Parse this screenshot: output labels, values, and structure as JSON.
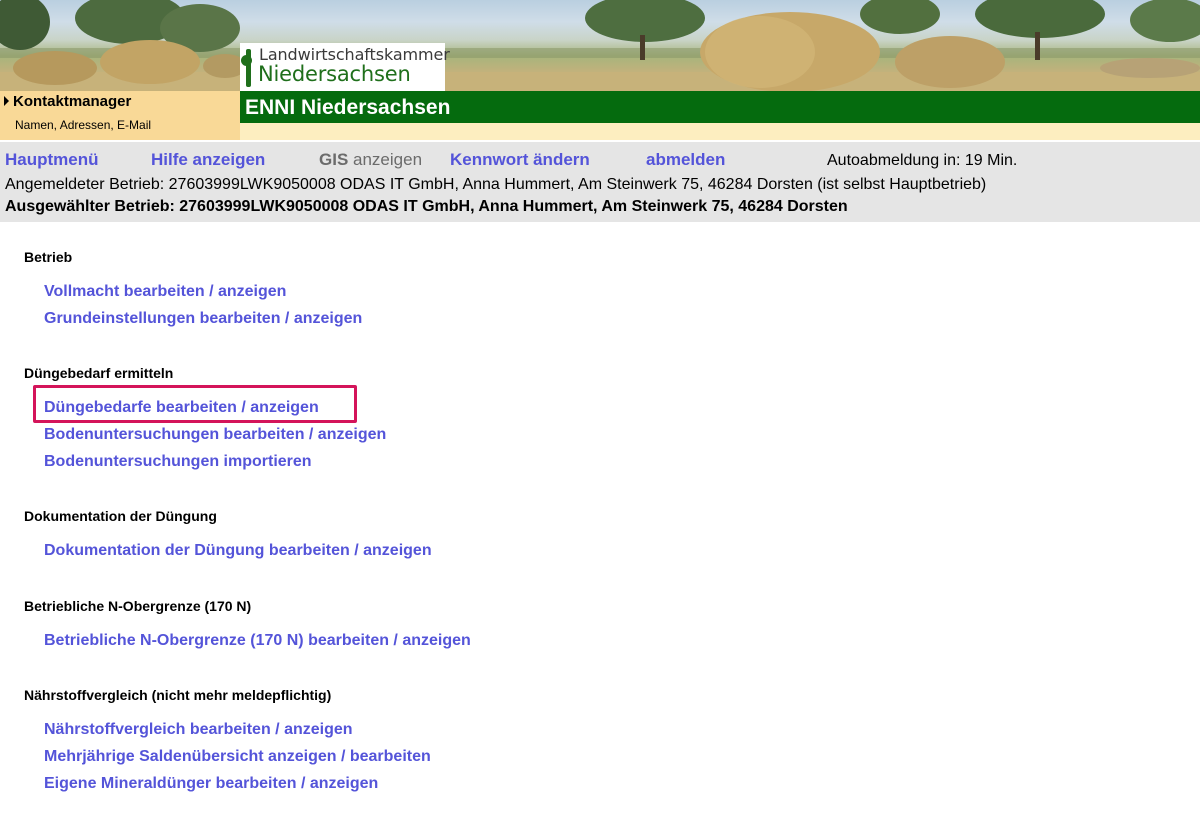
{
  "banner": {
    "logo_line1": "Landwirtschaftskammer",
    "logo_line2": "Niedersachsen"
  },
  "contact": {
    "title": "Kontaktmanager",
    "subtitle": "Namen, Adressen, E-Mail"
  },
  "app": {
    "title": "ENNI Niedersachsen"
  },
  "nav": {
    "main_menu": "Hauptmenü",
    "help": "Hilfe anzeigen",
    "gis_bold": "GIS",
    "gis_rest": " anzeigen",
    "change_password": "Kennwort ändern",
    "logout": "abmelden",
    "autologout": "Autoabmeldung in: 19 Min."
  },
  "info": {
    "logged_in": "Angemeldeter Betrieb: 27603999LWK9050008 ODAS IT GmbH, Anna Hummert, Am Steinwerk 75, 46284 Dorsten (ist selbst Hauptbetrieb)",
    "selected": "Ausgewählter Betrieb: 27603999LWK9050008 ODAS IT GmbH, Anna Hummert, Am Steinwerk 75, 46284 Dorsten"
  },
  "sections": [
    {
      "heading": "Betrieb",
      "links": [
        "Vollmacht bearbeiten / anzeigen",
        "Grundeinstellungen bearbeiten / anzeigen"
      ]
    },
    {
      "heading": "Düngebedarf ermitteln",
      "links": [
        "Düngebedarfe bearbeiten / anzeigen",
        "Bodenuntersuchungen bearbeiten / anzeigen",
        "Bodenuntersuchungen importieren"
      ]
    },
    {
      "heading": "Dokumentation der Düngung",
      "links": [
        "Dokumentation der Düngung bearbeiten / anzeigen"
      ]
    },
    {
      "heading": "Betriebliche N-Obergrenze (170 N)",
      "links": [
        "Betriebliche N-Obergrenze (170 N) bearbeiten / anzeigen"
      ]
    },
    {
      "heading": "Nährstoffvergleich (nicht mehr meldepflichtig)",
      "links": [
        "Nährstoffvergleich bearbeiten / anzeigen",
        "Mehrjährige Saldenübersicht anzeigen / bearbeiten",
        "Eigene Mineraldünger bearbeiten / anzeigen"
      ]
    }
  ],
  "colors": {
    "link": "#5454d9",
    "title_bar": "#056b0e",
    "contact_bg": "#f9d997",
    "highlight": "#d4145a"
  }
}
